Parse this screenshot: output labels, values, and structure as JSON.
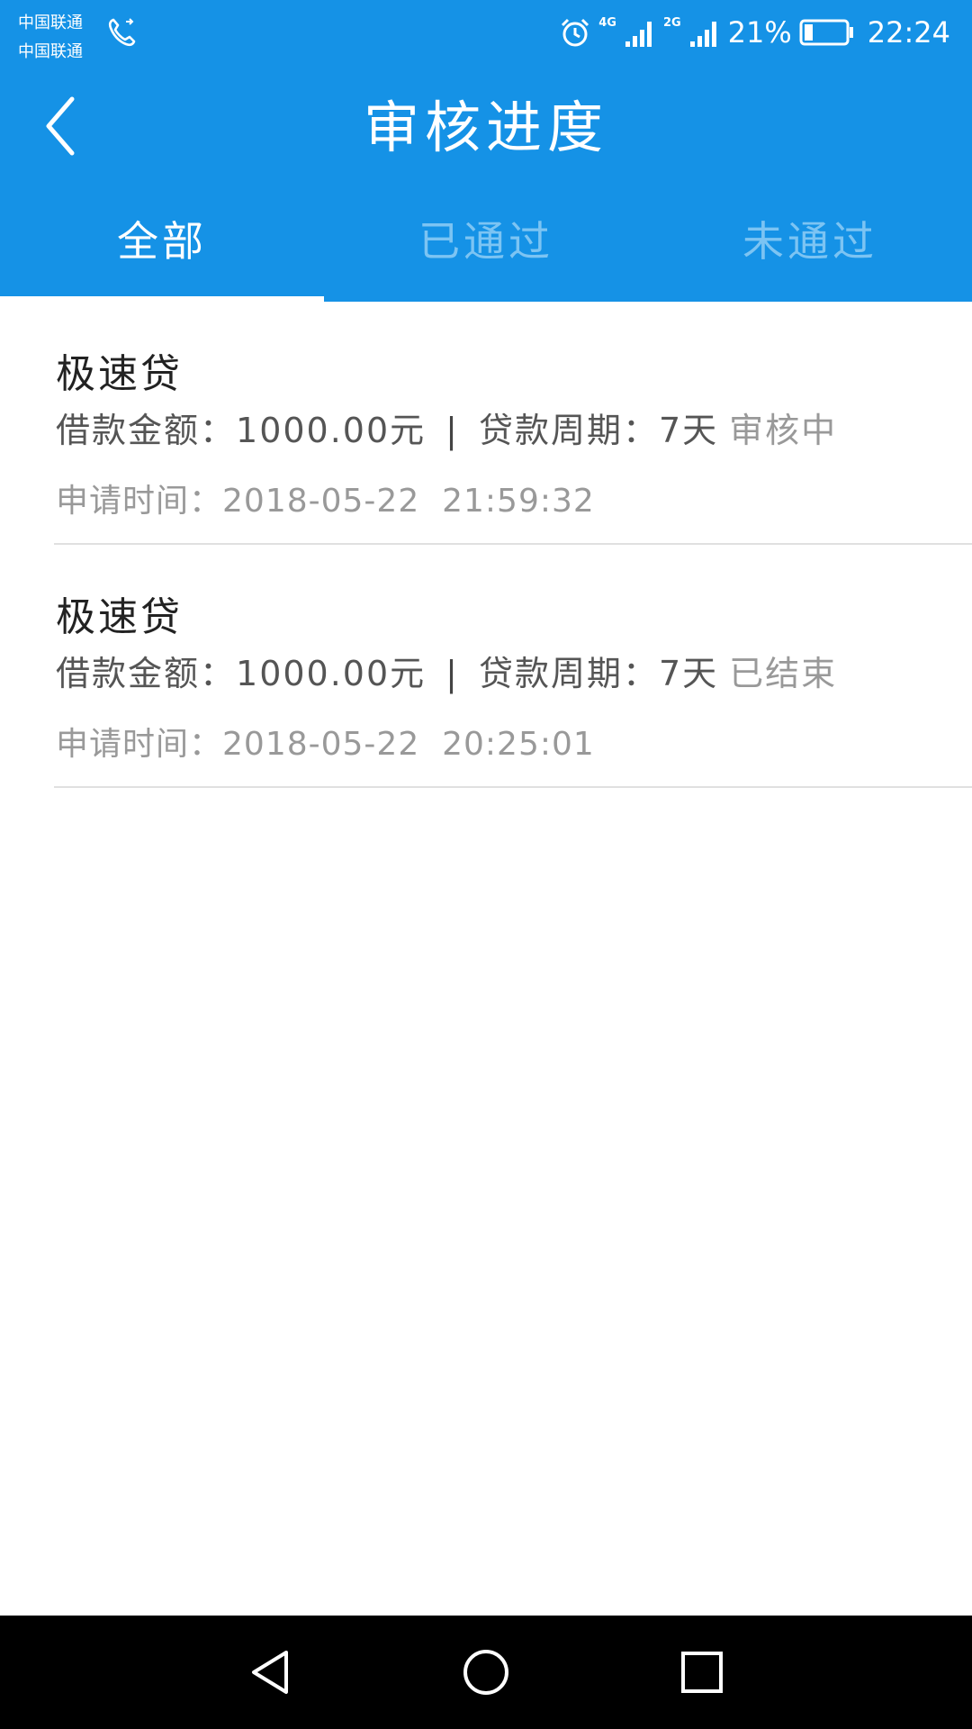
{
  "status_bar": {
    "carrier_1": "中国联通",
    "carrier_2": "中国联通",
    "net_1": "4G",
    "net_2": "2G",
    "battery_percent": "21%",
    "battery_level": 0.21,
    "time": "22:24"
  },
  "header": {
    "title": "审核进度",
    "back_icon": "chevron-left-icon"
  },
  "tabs": [
    {
      "label": "全部",
      "active": true
    },
    {
      "label": "已通过",
      "active": false
    },
    {
      "label": "未通过",
      "active": false
    }
  ],
  "records": [
    {
      "name": "极速贷",
      "amount_label": "借款金额：",
      "amount": "1000.00元",
      "separator": "|",
      "period_label": "贷款周期：",
      "period": "7天",
      "status": "审核中",
      "time_label": "申请时间：",
      "time": "2018-05-22  21:59:32"
    },
    {
      "name": "极速贷",
      "amount_label": "借款金额：",
      "amount": "1000.00元",
      "separator": "|",
      "period_label": "贷款周期：",
      "period": "7天",
      "status": "已结束",
      "time_label": "申请时间：",
      "time": "2018-05-22  20:25:01"
    }
  ],
  "colors": {
    "primary": "#1592e6",
    "inactive_tab": "#7cc4f3",
    "divider": "#e0e0e0"
  },
  "nav_bar": {
    "icons": [
      "back-triangle-icon",
      "home-circle-icon",
      "recents-square-icon"
    ]
  }
}
